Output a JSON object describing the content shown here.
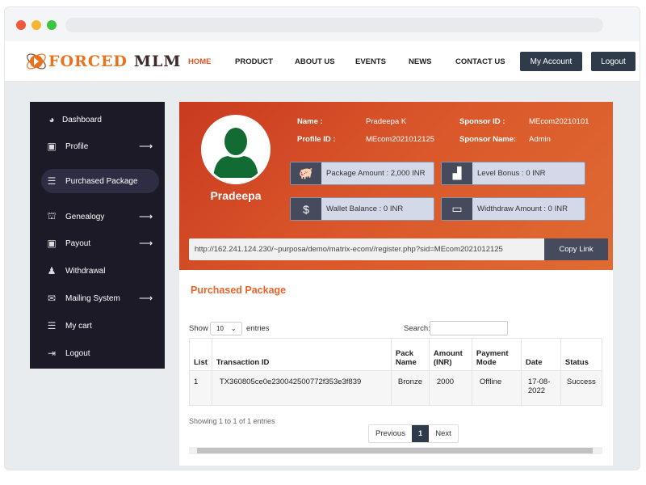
{
  "brand": {
    "part1": "FORCED",
    "part2": "MLM",
    "accent": "#e8731e"
  },
  "nav": [
    {
      "label": "HOME",
      "active": true
    },
    {
      "label": "PRODUCT"
    },
    {
      "label": "ABOUT US"
    },
    {
      "label": "EVENTS"
    },
    {
      "label": "NEWS"
    },
    {
      "label": "CONTACT US"
    }
  ],
  "header_buttons": {
    "account": "My Account",
    "logout": "Logout"
  },
  "sidebar": [
    {
      "label": "Dashboard",
      "icon": "dashboard-icon"
    },
    {
      "label": "Profile",
      "icon": "id-card-icon",
      "arrow": "⟶"
    },
    {
      "label": "Purchased Package",
      "icon": "coins-icon",
      "active": true
    },
    {
      "label": "Genealogy",
      "icon": "sitemap-icon",
      "arrow": "⟶"
    },
    {
      "label": "Payout",
      "icon": "id-card-icon",
      "arrow": "⟶"
    },
    {
      "label": "Withdrawal",
      "icon": "piggy-bank-icon"
    },
    {
      "label": "Mailing System",
      "icon": "envelope-icon",
      "arrow": "⟶"
    },
    {
      "label": "My cart",
      "icon": "coins-icon"
    },
    {
      "label": "Logout",
      "icon": "sign-out-icon"
    }
  ],
  "profile": {
    "display_name": "Pradeepa",
    "name_label": "Name :",
    "name": "Pradeepa K",
    "profile_id_label": "Profile ID :",
    "profile_id": "MEcom2021012125",
    "sponsor_id_label": "Sponsor ID :",
    "sponsor_id": "MEcom20210101",
    "sponsor_name_label": "Sponsor Name:",
    "sponsor_name": "Admin"
  },
  "stats": {
    "package": "Package Amount : 2,000 INR",
    "level": "Level Bonus : 0 INR",
    "wallet": "Wallet Balance : 0 INR",
    "withdraw": "Widthdraw Amount : 0 INR"
  },
  "referral": {
    "url": "http://162.241.124.230/~purposa/demo/matrix-ecom//register.php?sid=MEcom2021012125",
    "copy": "Copy Link"
  },
  "section_title": "Purchased Package",
  "table_controls": {
    "show": "Show",
    "entries": "entries",
    "page_size": "10",
    "search": "Search:",
    "search_value": ""
  },
  "table": {
    "headers": [
      "List",
      "Transaction ID",
      "Pack Name",
      "Amount (INR)",
      "Payment Mode",
      "Date",
      "Status"
    ],
    "rows": [
      [
        "1",
        "TX360805ce0e230042500772f353e3f839",
        "Bronze",
        "2000",
        "Offline",
        "17-08-2022",
        "Success"
      ]
    ]
  },
  "info": "Showing 1 to 1 of 1 entries",
  "pagination": {
    "prev": "Previous",
    "current": "1",
    "next": "Next"
  }
}
